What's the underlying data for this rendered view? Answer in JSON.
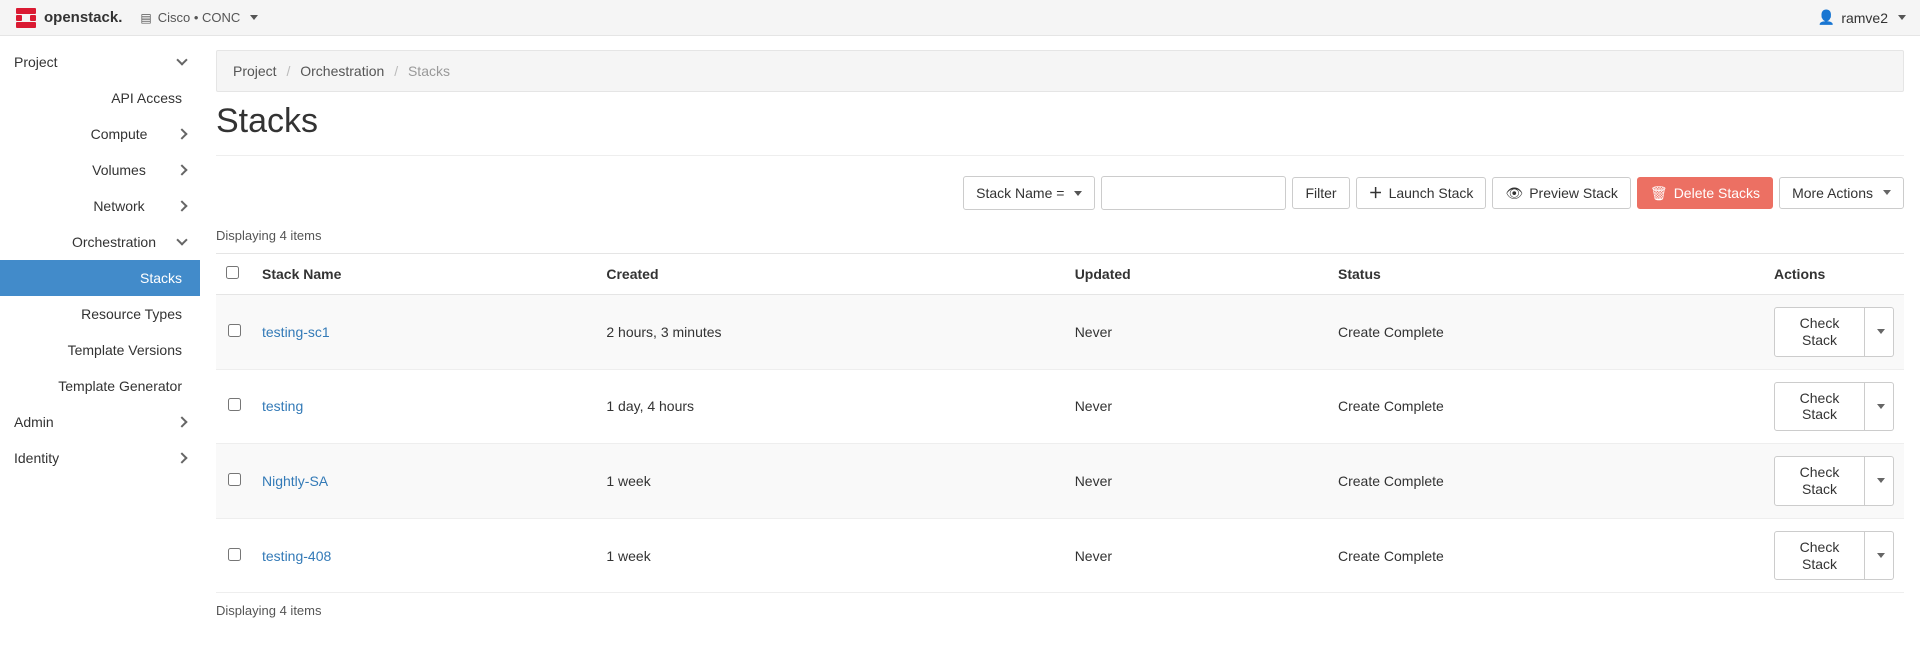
{
  "navbar": {
    "brand": "openstack.",
    "project_selector": "Cisco • CONC",
    "user": "ramve2"
  },
  "sidebar": {
    "project": "Project",
    "api_access": "API Access",
    "compute": "Compute",
    "volumes": "Volumes",
    "network": "Network",
    "orchestration": "Orchestration",
    "stacks": "Stacks",
    "resource_types": "Resource Types",
    "template_versions": "Template Versions",
    "template_generator": "Template Generator",
    "admin": "Admin",
    "identity": "Identity"
  },
  "breadcrumb": {
    "project": "Project",
    "orchestration": "Orchestration",
    "current": "Stacks"
  },
  "title": "Stacks",
  "toolbar": {
    "filter_field": "Stack Name =",
    "filter_btn": "Filter",
    "launch_btn": "Launch Stack",
    "preview_btn": "Preview Stack",
    "delete_btn": "Delete Stacks",
    "more_actions": "More Actions"
  },
  "table": {
    "count_top": "Displaying 4 items",
    "count_bottom": "Displaying 4 items",
    "headers": {
      "name": "Stack Name",
      "created": "Created",
      "updated": "Updated",
      "status": "Status",
      "actions": "Actions"
    },
    "rows": [
      {
        "name": "testing-sc1",
        "created": "2 hours, 3 minutes",
        "updated": "Never",
        "status": "Create Complete",
        "action": "Check Stack"
      },
      {
        "name": "testing",
        "created": "1 day, 4 hours",
        "updated": "Never",
        "status": "Create Complete",
        "action": "Check Stack"
      },
      {
        "name": "Nightly-SA",
        "created": "1 week",
        "updated": "Never",
        "status": "Create Complete",
        "action": "Check Stack"
      },
      {
        "name": "testing-408",
        "created": "1 week",
        "updated": "Never",
        "status": "Create Complete",
        "action": "Check Stack"
      }
    ]
  }
}
